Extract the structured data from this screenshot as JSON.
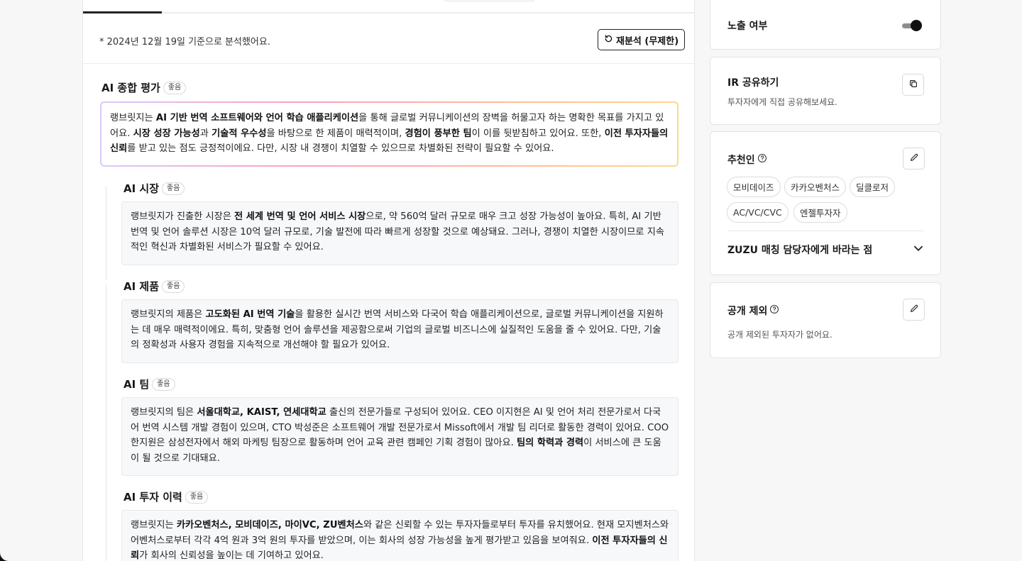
{
  "analysis": {
    "note": "* 2024년 12월 19일 기준으로 분석했어요.",
    "reanalyze_label": "재분석 (무제한)"
  },
  "overall": {
    "title": "AI 종합 평가",
    "badge": "좋음",
    "text_parts": [
      {
        "t": "랭브릿지는 ",
        "b": false
      },
      {
        "t": "AI 기반 번역 소프트웨어와 언어 학습 애플리케이션",
        "b": true
      },
      {
        "t": "을 통해 글로벌 커뮤니케이션의 장벽을 허물고자 하는 명확한 목표를 가지고 있어요. ",
        "b": false
      },
      {
        "t": "시장 성장 가능성",
        "b": true
      },
      {
        "t": "과 ",
        "b": false
      },
      {
        "t": "기술적 우수성",
        "b": true
      },
      {
        "t": "을 바탕으로 한 제품이 매력적이며, ",
        "b": false
      },
      {
        "t": "경험이 풍부한 팀",
        "b": true
      },
      {
        "t": "이 이를 뒷받침하고 있어요. 또한, ",
        "b": false
      },
      {
        "t": "이전 투자자들의 신뢰",
        "b": true
      },
      {
        "t": "를 받고 있는 점도 긍정적이에요. 다만, 시장 내 경쟁이 치열할 수 있으므로 차별화된 전략이 필요할 수 있어요.",
        "b": false
      }
    ]
  },
  "sections": [
    {
      "title": "AI 시장",
      "badge": "좋음",
      "text_parts": [
        {
          "t": "랭브릿지가 진출한 시장은 ",
          "b": false
        },
        {
          "t": "전 세계 번역 및 언어 서비스 시장",
          "b": true
        },
        {
          "t": "으로, 약 560억 달러 규모로 매우 크고 성장 가능성이 높아요. 특히, AI 기반 번역 및 언어 솔루션 시장은 10억 달러 규모로, 기술 발전에 따라 빠르게 성장할 것으로 예상돼요. 그러나, 경쟁이 치열한 시장이므로 지속적인 혁신과 차별화된 서비스가 필요할 수 있어요.",
          "b": false
        }
      ]
    },
    {
      "title": "AI 제품",
      "badge": "좋음",
      "text_parts": [
        {
          "t": "랭브릿지의 제품은 ",
          "b": false
        },
        {
          "t": "고도화된 AI 번역 기술",
          "b": true
        },
        {
          "t": "을 활용한 실시간 번역 서비스와 다국어 학습 애플리케이션으로, 글로벌 커뮤니케이션을 지원하는 데 매우 매력적이에요. 특히, 맞춤형 언어 솔루션을 제공함으로써 기업의 글로벌 비즈니스에 실질적인 도움을 줄 수 있어요. 다만, 기술의 정확성과 사용자 경험을 지속적으로 개선해야 할 필요가 있어요.",
          "b": false
        }
      ]
    },
    {
      "title": "AI 팀",
      "badge": "좋음",
      "text_parts": [
        {
          "t": "랭브릿지의 팀은 ",
          "b": false
        },
        {
          "t": "서울대학교, KAIST, 연세대학교",
          "b": true
        },
        {
          "t": " 출신의 전문가들로 구성되어 있어요. CEO 이지현은 AI 및 언어 처리 전문가로서 다국어 번역 시스템 개발 경험이 있으며, CTO 박성준은 소프트웨어 개발 전문가로서 Missoft에서 개발 팀 리더로 활동한 경력이 있어요. COO 한지원은 삼성전자에서 해외 마케팅 팀장으로 활동하며 언어 교육 관련 캠페인 기획 경험이 많아요. ",
          "b": false
        },
        {
          "t": "팀의 학력과 경력",
          "b": true
        },
        {
          "t": "이 서비스에 큰 도움이 될 것으로 기대돼요.",
          "b": false
        }
      ]
    },
    {
      "title": "AI 투자 이력",
      "badge": "좋음",
      "text_parts": [
        {
          "t": "랭브릿지는 ",
          "b": false
        },
        {
          "t": "카카오벤처스, 모비데이즈, 마이VC, ZU벤처스",
          "b": true
        },
        {
          "t": "와 같은 신뢰할 수 있는 투자자들로부터 투자를 유치했어요. 현재 모지벤처스와 어벤처스로부터 각각 4억 원과 3억 원의 투자를 받았으며, 이는 회사의 성장 가능성을 높게 평가받고 있음을 보여줘요. ",
          "b": false
        },
        {
          "t": "이전 투자자들의 신뢰",
          "b": true
        },
        {
          "t": "가 회사의 신뢰성을 높이는 데 기여하고 있어요.",
          "b": false
        }
      ]
    }
  ],
  "sidebar": {
    "exposure": {
      "label": "노출 여부",
      "enabled": true
    },
    "ir_share": {
      "title": "IR 공유하기",
      "subtitle": "투자자에게 직접 공유해보세요."
    },
    "recommenders": {
      "title": "추천인",
      "chips": [
        "모비데이즈",
        "카카오벤처스",
        "딜클로저",
        "AC/VC/CVC",
        "엔젤투자자"
      ],
      "accordion_label": "ZUZU 매칭 담당자에게 바라는 점"
    },
    "exclusion": {
      "title": "공개 제외",
      "subtitle": "공개 제외된 투자자가 없어요."
    }
  },
  "colors": {
    "accent_dark": "#111111",
    "gradient": [
      "#d9c8ff",
      "#ff9fc0",
      "#ffb6a0",
      "#ffd88a"
    ]
  },
  "icons": {
    "reanalyze": "refresh-icon",
    "copy": "copy-icon",
    "edit": "pencil-icon",
    "help": "help-circle-icon",
    "chevron": "chevron-down-icon"
  }
}
